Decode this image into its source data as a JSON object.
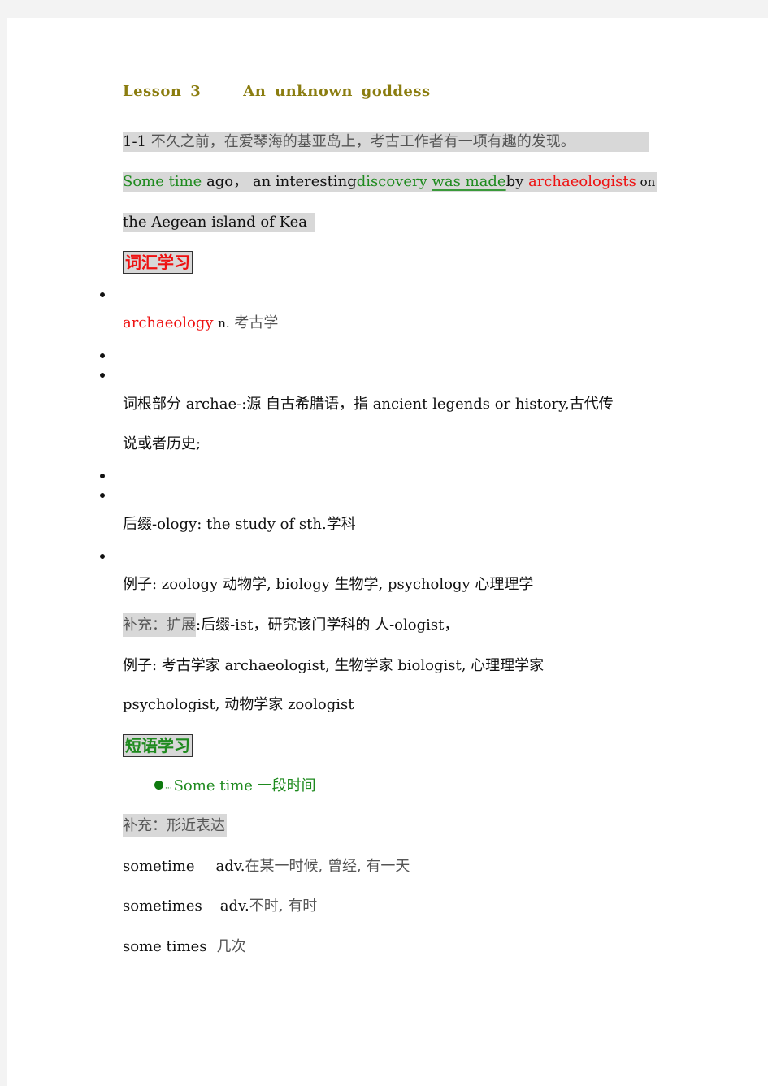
{
  "lesson": {
    "number_label": "Lesson  3",
    "title": "An  unknown  goddess"
  },
  "sentence": {
    "id": "1-1",
    "chinese": "不久之前，在爱琴海的基亚岛上，考古工作者有一项有趣的发现。",
    "english_parts": [
      {
        "text": "Some  time",
        "style": "green"
      },
      {
        "text": " ago，  an  interesting",
        "style": "black"
      },
      {
        "text": "discovery ",
        "style": "green"
      },
      {
        "text": "was  made",
        "style": "green-underline"
      },
      {
        "text": "by ",
        "style": "black"
      },
      {
        "text": "archaeologists",
        "style": "red"
      },
      {
        "text": "  on",
        "style": "black"
      }
    ],
    "english_line2": "the  Aegean  island  of  Kea"
  },
  "vocab_section": {
    "heading": "词汇学习",
    "word": "archaeology",
    "pos": "n.",
    "meaning": "考古学",
    "root_line1": "词根部分 archae-:源 自古希腊语，指 ancient  legends  or  history,古代传",
    "root_line2": "说或者历史;",
    "suffix_line": "后缀-ology:  the  study  of  sth.学科",
    "example_line": "例子:  zoology 动物学,  biology  生物学,  psychology  心理理学",
    "supplement_label": "补充：扩展",
    "supplement_text": ":后缀-ist，研究该门学科的 人-ologist，",
    "example2_line1": "例子: 考古学家   archaeologist,  生物学家   biologist,  心理理学家",
    "example2_line2": "psychologist, 动物学家 zoologist"
  },
  "phrase_section": {
    "heading": "短语学习",
    "phrase": "Some  time",
    "phrase_meaning": "一段时间",
    "supplement_label": "补充：形近表达",
    "entries": [
      {
        "term": "sometime",
        "pos": "adv.",
        "meaning": "在某一时候, 曾经, 有一天"
      },
      {
        "term": "sometimes",
        "pos": "adv.",
        "meaning": "不时, 有时"
      },
      {
        "term": "some  times",
        "pos": "",
        "meaning": "几次"
      }
    ]
  },
  "colors": {
    "title": "#8b7d10",
    "highlight": "#d8d8d8",
    "green": "#1e8a1e",
    "red": "#ee1111",
    "page_bg": "#f3f3f3"
  }
}
